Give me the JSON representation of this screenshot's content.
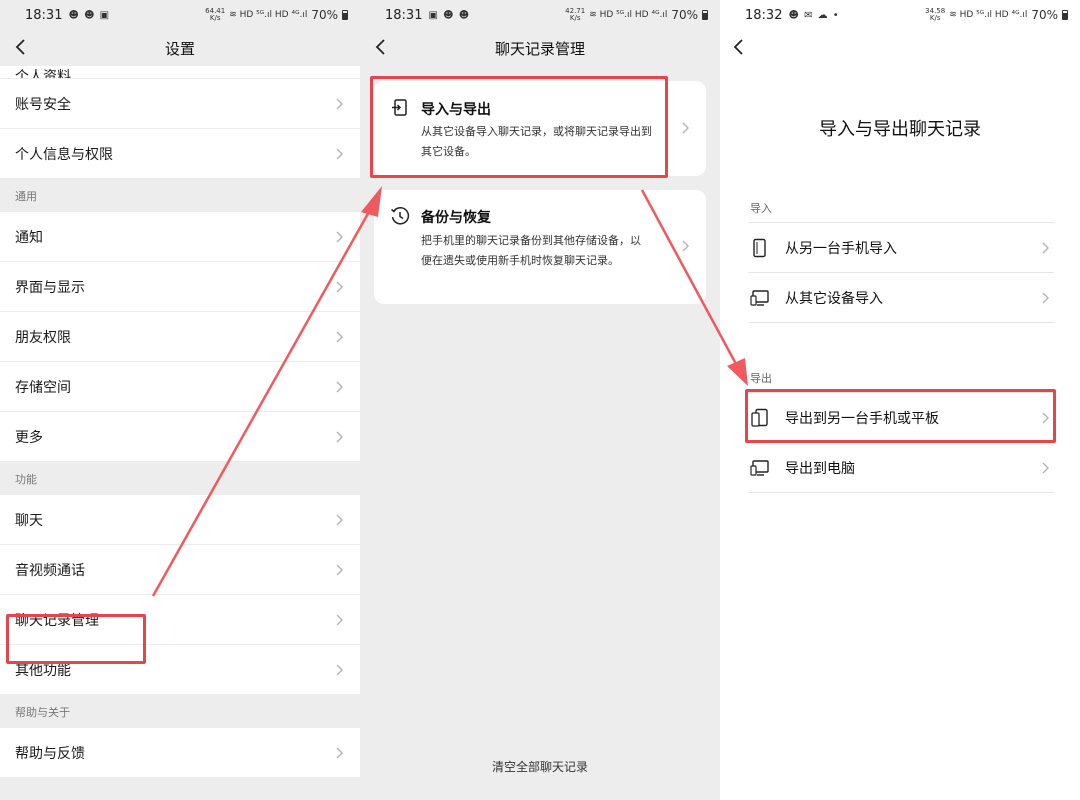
{
  "panel1": {
    "status": {
      "time": "18:31",
      "speed_value": "64.41",
      "speed_unit": "K/s",
      "battery": "70%"
    },
    "title": "设置",
    "rows_top": [
      {
        "label": "个人资料"
      },
      {
        "label": "账号安全"
      },
      {
        "label": "个人信息与权限"
      }
    ],
    "sections": [
      {
        "header": "通用",
        "items": [
          {
            "label": "通知"
          },
          {
            "label": "界面与显示"
          },
          {
            "label": "朋友权限"
          },
          {
            "label": "存储空间"
          },
          {
            "label": "更多"
          }
        ]
      },
      {
        "header": "功能",
        "items": [
          {
            "label": "聊天"
          },
          {
            "label": "音视频通话"
          },
          {
            "label": "聊天记录管理"
          },
          {
            "label": "其他功能"
          }
        ]
      },
      {
        "header": "帮助与关于",
        "items": [
          {
            "label": "帮助与反馈"
          }
        ]
      }
    ]
  },
  "panel2": {
    "status": {
      "time": "18:31",
      "speed_value": "42.71",
      "speed_unit": "K/s",
      "battery": "70%"
    },
    "title": "聊天记录管理",
    "cards": [
      {
        "icon": "import-export-icon",
        "title": "导入与导出",
        "desc": "从其它设备导入聊天记录，或将聊天记录导出到其它设备。"
      },
      {
        "icon": "history-clock-icon",
        "title": "备份与恢复",
        "desc": "把手机里的聊天记录备份到其他存储设备，以便在遗失或使用新手机时恢复聊天记录。"
      }
    ],
    "clear_all": "清空全部聊天记录"
  },
  "panel3": {
    "status": {
      "time": "18:32",
      "speed_value": "34.58",
      "speed_unit": "K/s",
      "battery": "70%"
    },
    "title": "导入与导出聊天记录",
    "import_header": "导入",
    "import_items": [
      {
        "icon": "phone-icon",
        "label": "从另一台手机导入"
      },
      {
        "icon": "monitor-icon",
        "label": "从其它设备导入"
      }
    ],
    "export_header": "导出",
    "export_items": [
      {
        "icon": "phone-tablet-icon",
        "label": "导出到另一台手机或平板"
      },
      {
        "icon": "monitor-icon",
        "label": "导出到电脑"
      }
    ]
  },
  "colors": {
    "highlight": "#e5454d",
    "arrow": "#ef5a5f",
    "page_bg": "#ededed"
  }
}
